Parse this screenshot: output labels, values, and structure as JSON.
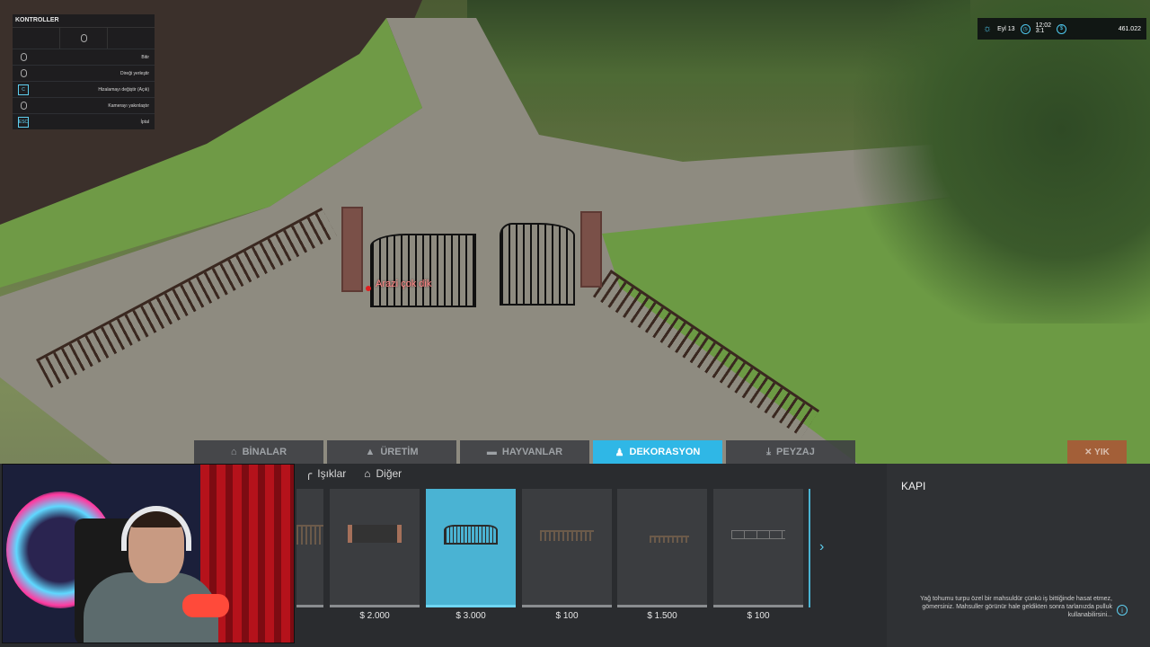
{
  "controls": {
    "title": "KONTROLLER",
    "rows": [
      {
        "key": "",
        "key_icon": "mouse-icon",
        "label": "Bitir"
      },
      {
        "key": "",
        "key_icon": "mouse-icon",
        "label": "Direği yerleştir"
      },
      {
        "key": "C",
        "key_icon": "key-c",
        "label": "Hizalamayı değiştir (Açık)"
      },
      {
        "key": "",
        "key_icon": "mouse-icon",
        "label": "Kamerayı yakınlaştır"
      },
      {
        "key": "ESC",
        "key_icon": "key-esc",
        "label": "İptal"
      }
    ]
  },
  "hud": {
    "weather_icon": "sun-icon",
    "date": "Eyl 13",
    "time_line1": "12:02",
    "time_line2": "3:1",
    "money": "461.022"
  },
  "scene": {
    "warning": "Arazi çok dik"
  },
  "tabs": [
    {
      "label": "BİNALAR",
      "icon": "barn-icon",
      "active": false
    },
    {
      "label": "ÜRETİM",
      "icon": "factory-icon",
      "active": false
    },
    {
      "label": "HAYVANLAR",
      "icon": "cow-icon",
      "active": false
    },
    {
      "label": "DEKORASYON",
      "icon": "decoration-icon",
      "active": true
    },
    {
      "label": "PEYZAJ",
      "icon": "shovel-icon",
      "active": false
    }
  ],
  "cancel_label": "✕ YIK",
  "subtabs": [
    {
      "label": "Işıklar",
      "icon": "lamp-icon"
    },
    {
      "label": "Diğer",
      "icon": "home-icon"
    }
  ],
  "items": [
    {
      "price": "",
      "thumb": "fence-partial",
      "selected": false
    },
    {
      "price": "$ 2.000",
      "thumb": "gate-posts",
      "selected": false
    },
    {
      "price": "$ 3.000",
      "thumb": "gate",
      "selected": true
    },
    {
      "price": "$ 100",
      "thumb": "fence",
      "selected": false
    },
    {
      "price": "$ 1.500",
      "thumb": "fence-low",
      "selected": false
    },
    {
      "price": "$ 100",
      "thumb": "fence-rail",
      "selected": false
    }
  ],
  "info": {
    "title": "KAPI",
    "description": "Yağ tohumu turpu özel bir mahsuldür çünkü iş bittiğinde hasat etmez, gömersiniz. Mahsuller görünür hale geldikten sonra tarlanızda pulluk kullanabilirsini..."
  },
  "colors": {
    "accent": "#2fb7e6",
    "selected_item": "#4ab3d3",
    "panel": "#2a2c2f",
    "warning": "#ff8a8a"
  }
}
